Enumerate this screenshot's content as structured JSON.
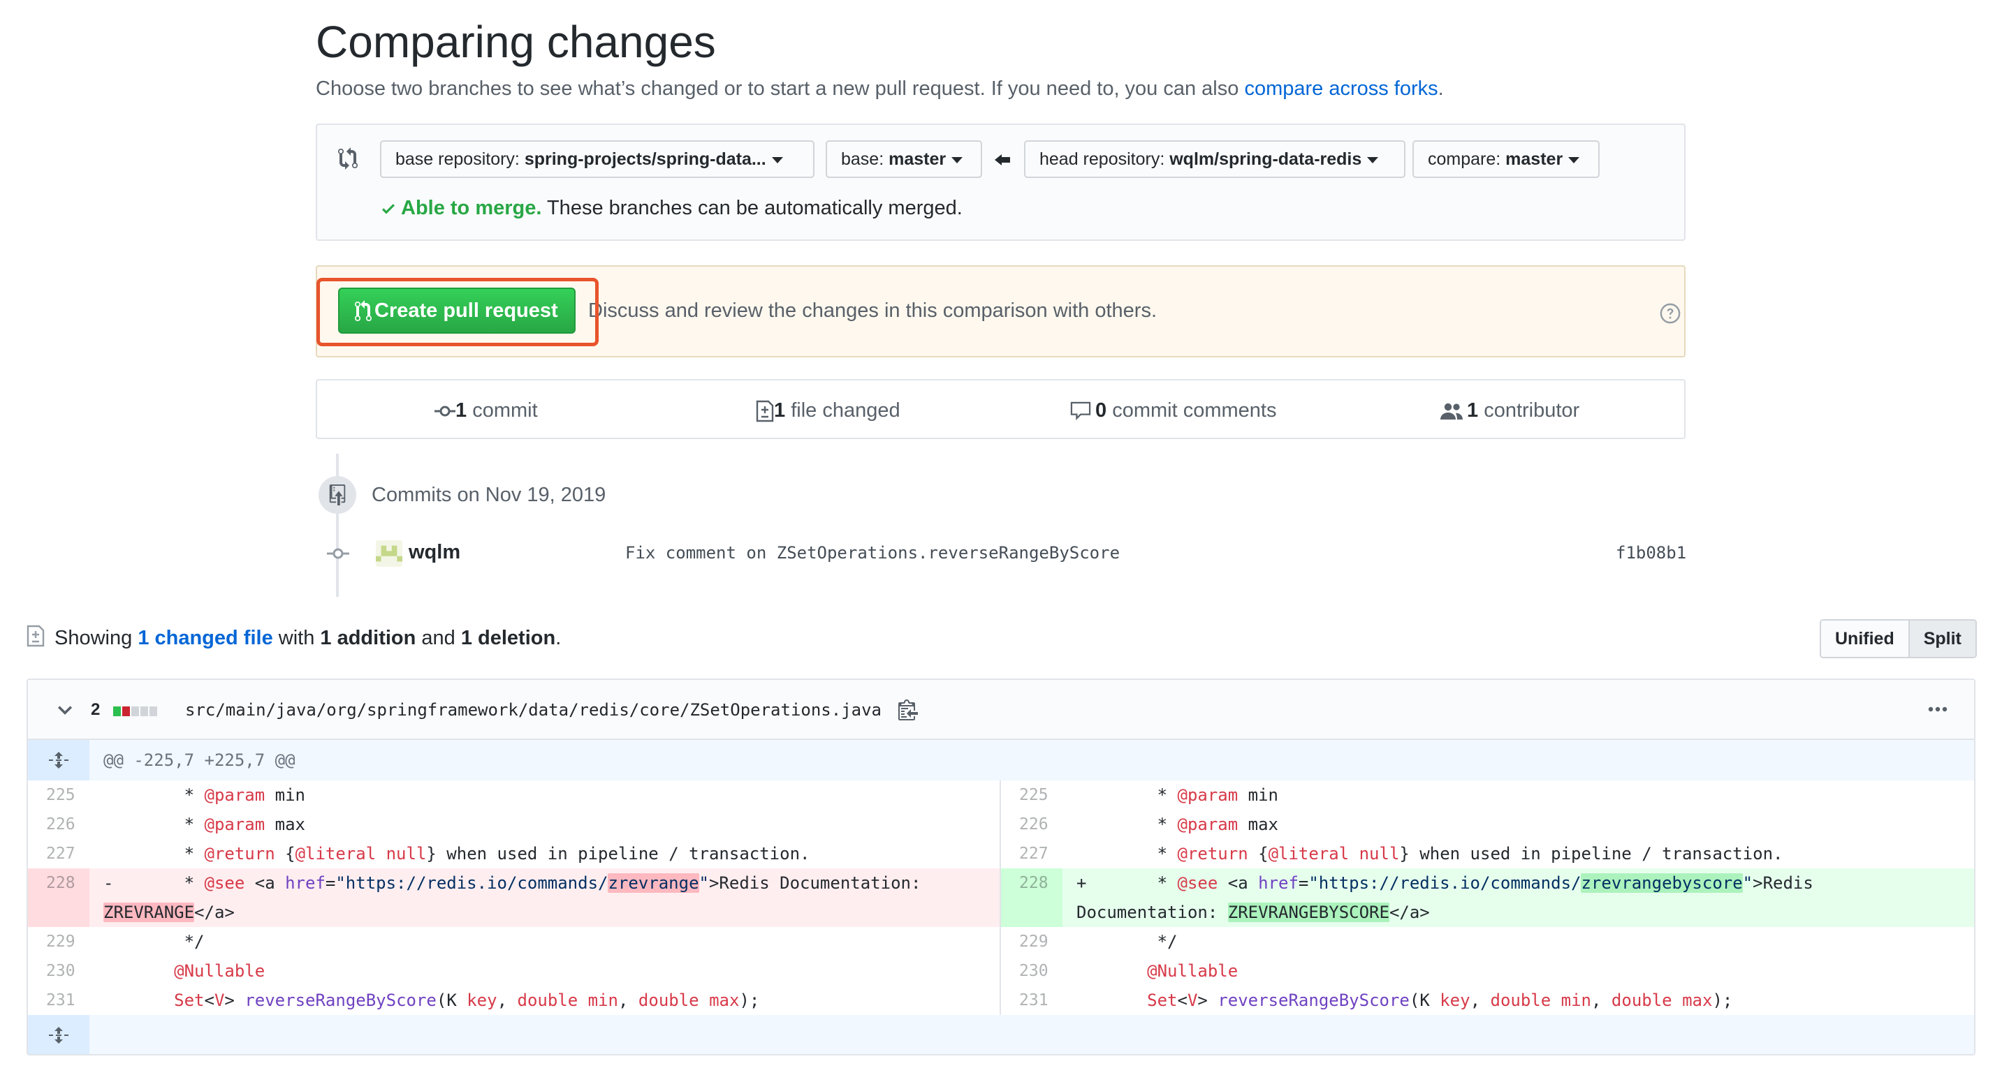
{
  "header": {
    "title": "Comparing changes",
    "subtitle_prefix": "Choose two branches to see what’s changed or to start a new pull request. If you need to, you can also ",
    "subtitle_link": "compare across forks",
    "subtitle_suffix": "."
  },
  "range": {
    "base_repo_label": "base repository:",
    "base_repo_value": "spring-projects/spring-data...",
    "base_label": "base:",
    "base_value": "master",
    "head_repo_label": "head repository:",
    "head_repo_value": "wqlm/spring-data-redis",
    "compare_label": "compare:",
    "compare_value": "master",
    "merge_ok": "Able to merge.",
    "merge_msg": " These branches can be automatically merged."
  },
  "pr": {
    "button_label": "Create pull request",
    "description": "Discuss and review the changes in this comparison with others."
  },
  "summary": {
    "commits_count": "1",
    "commits_label": " commit",
    "files_count": "1",
    "files_label": " file changed",
    "comments_count": "0",
    "comments_label": " commit comments",
    "contributors_count": "1",
    "contributors_label": " contributor"
  },
  "commits": {
    "date_heading": "Commits on Nov 19, 2019",
    "items": [
      {
        "author": "wqlm",
        "message": "Fix comment on ZSetOperations.reverseRangeByScore",
        "sha": "f1b08b1"
      }
    ]
  },
  "showing": {
    "prefix": "Showing ",
    "link": "1 changed file",
    "with": " with ",
    "additions": "1 addition",
    "and": " and ",
    "deletions": "1 deletion",
    "suffix": "."
  },
  "view_toggle": {
    "unified": "Unified",
    "split": "Split",
    "selected": "Split"
  },
  "file": {
    "change_count": "2",
    "path": "src/main/java/org/springframework/data/redis/core/ZSetOperations.java",
    "hunk": "@@ -225,7 +225,7 @@",
    "line_numbers": [
      "225",
      "226",
      "227",
      "228",
      "229",
      "230",
      "231"
    ],
    "colors": {
      "deletion_bg": "#ffeef0",
      "deletion_gutter": "#ffdce0",
      "addition_bg": "#e6ffed",
      "addition_gutter": "#cdffd8",
      "highlight": "#e8542c",
      "green": "#28a745"
    }
  },
  "icons": [
    "git-compare-icon",
    "arrow-left-icon",
    "check-icon",
    "git-pull-request-icon",
    "question-icon",
    "commit-icon",
    "file-diff-icon",
    "comment-icon",
    "people-icon",
    "repo-push-icon",
    "avatar",
    "chevron-down-icon",
    "clipboard-icon",
    "kebab-horizontal-icon",
    "unfold-icon"
  ]
}
